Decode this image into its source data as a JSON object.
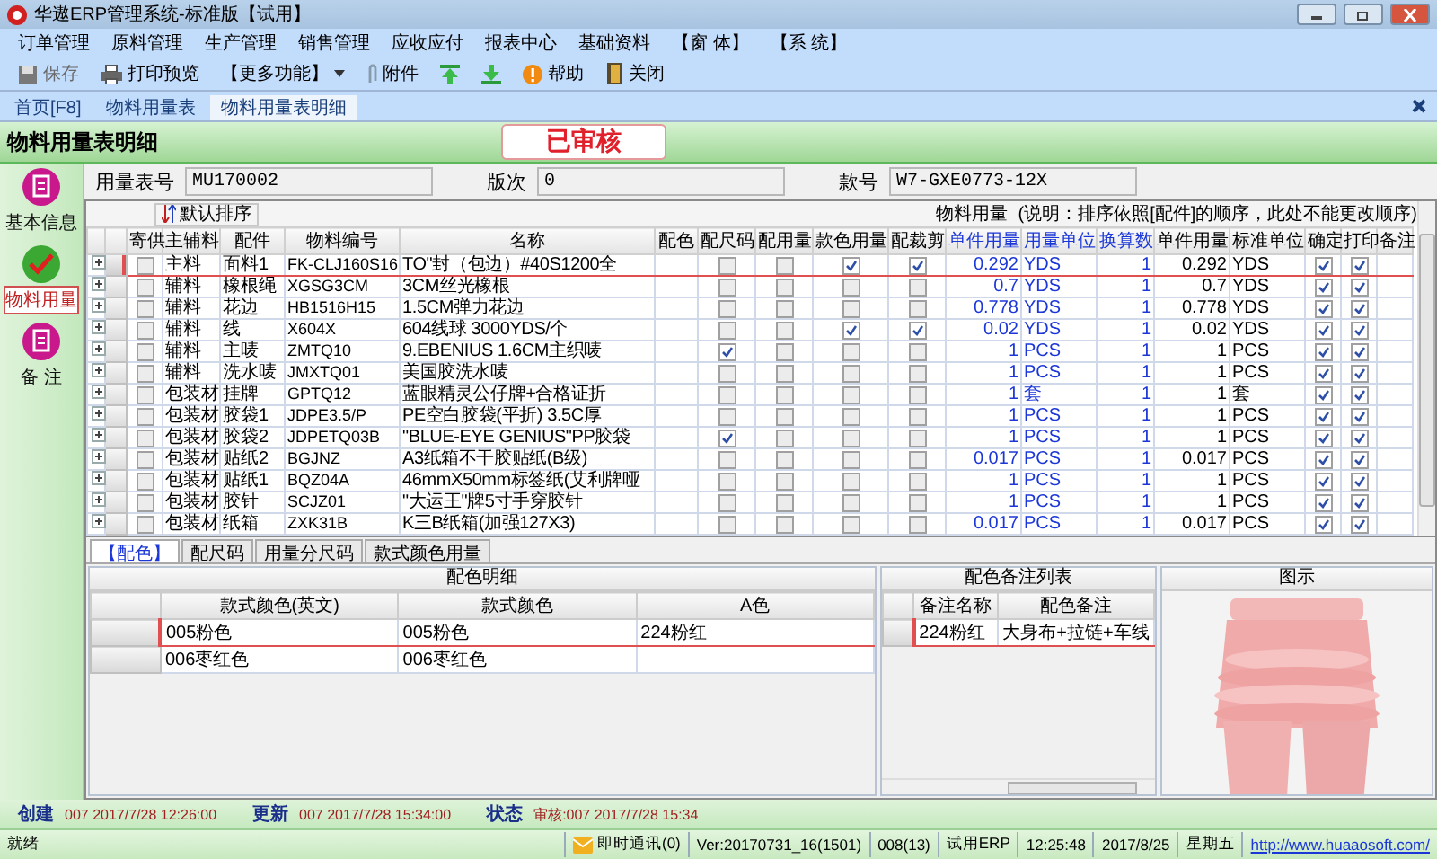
{
  "window": {
    "title": "华遨ERP管理系统-标准版【试用】"
  },
  "menu": [
    "订单管理",
    "原料管理",
    "生产管理",
    "销售管理",
    "应收应付",
    "报表中心",
    "基础资料",
    "【窗 体】",
    "【系 统】"
  ],
  "toolbar": [
    {
      "kind": "save",
      "label": "保存",
      "disabled": true
    },
    {
      "kind": "print",
      "label": "打印预览",
      "disabled": false
    },
    {
      "kind": "more",
      "label": "【更多功能】",
      "disabled": false
    },
    {
      "kind": "attach",
      "label": "附件",
      "disabled": false
    },
    {
      "kind": "up",
      "disabled": false
    },
    {
      "kind": "down",
      "disabled": false
    },
    {
      "kind": "help",
      "label": "帮助",
      "disabled": false
    },
    {
      "kind": "close",
      "label": "关闭",
      "disabled": false
    }
  ],
  "doc_tabs": [
    {
      "label": "首页[F8]",
      "selected": false
    },
    {
      "label": "物料用量表",
      "selected": false
    },
    {
      "label": "物料用量表明细",
      "selected": true
    }
  ],
  "page": {
    "title": "物料用量表明细",
    "status_badge": "已审核"
  },
  "fields": [
    {
      "label": "用量表号",
      "value": "MU170002"
    },
    {
      "label": "版次",
      "value": "0"
    },
    {
      "label": "款号",
      "value": "W7-GXE0773-12X"
    }
  ],
  "sidebar": [
    {
      "label": "基本信息",
      "selected": false
    },
    {
      "label": "物料用量",
      "selected": true
    },
    {
      "label": "备 注",
      "selected": false
    }
  ],
  "grid": {
    "sort_button": "默认排序",
    "caption": "物料用量",
    "note": "(说明：排序依照[配件]的顺序，此处不能更改顺序)",
    "columns": [
      {
        "label": "寄供",
        "editable": false
      },
      {
        "label": "主辅料",
        "editable": false
      },
      {
        "label": "配件",
        "editable": false
      },
      {
        "label": "物料编号",
        "editable": false
      },
      {
        "label": "名称",
        "editable": false
      },
      {
        "label": "配色",
        "editable": false
      },
      {
        "label": "配尺码",
        "editable": false
      },
      {
        "label": "配用量",
        "editable": false
      },
      {
        "label": "款色用量",
        "editable": false
      },
      {
        "label": "配裁剪",
        "editable": false
      },
      {
        "label": "单件用量",
        "editable": true
      },
      {
        "label": "用量单位",
        "editable": true
      },
      {
        "label": "换算数",
        "editable": true
      },
      {
        "label": "单件用量",
        "editable": false
      },
      {
        "label": "标准单位",
        "editable": false
      },
      {
        "label": "确定",
        "editable": false
      },
      {
        "label": "打印",
        "editable": false
      },
      {
        "label": "备注",
        "editable": false
      }
    ],
    "rows": [
      {
        "selected": true,
        "supply": false,
        "type": "主料",
        "part": "面料1",
        "code": "FK-CLJ160S16",
        "name": "TO\"封（包边）#40S1200全",
        "size": false,
        "qty": false,
        "style_color": true,
        "cutting": true,
        "usage": "0.292",
        "unit": "YDS",
        "factor": "1",
        "std_usage": "0.292",
        "std_unit": "YDS",
        "confirm": true,
        "print": true
      },
      {
        "selected": false,
        "supply": false,
        "type": "辅料",
        "part": "橡根绳",
        "code": "XGSG3CM",
        "name": "3CM丝光橡根",
        "size": false,
        "qty": false,
        "style_color": false,
        "cutting": false,
        "usage": "0.7",
        "unit": "YDS",
        "factor": "1",
        "std_usage": "0.7",
        "std_unit": "YDS",
        "confirm": true,
        "print": true
      },
      {
        "selected": false,
        "supply": false,
        "type": "辅料",
        "part": "花边",
        "code": "HB1516H15",
        "name": "1.5CM弹力花边",
        "size": false,
        "qty": false,
        "style_color": false,
        "cutting": false,
        "usage": "0.778",
        "unit": "YDS",
        "factor": "1",
        "std_usage": "0.778",
        "std_unit": "YDS",
        "confirm": true,
        "print": true
      },
      {
        "selected": false,
        "supply": false,
        "type": "辅料",
        "part": "线",
        "code": "X604X",
        "name": "604线球 3000YDS/个",
        "size": false,
        "qty": false,
        "style_color": true,
        "cutting": true,
        "usage": "0.02",
        "unit": "YDS",
        "factor": "1",
        "std_usage": "0.02",
        "std_unit": "YDS",
        "confirm": true,
        "print": true
      },
      {
        "selected": false,
        "supply": false,
        "type": "辅料",
        "part": "主唛",
        "code": "ZMTQ10",
        "name": "9.EBENIUS 1.6CM主织唛",
        "size": true,
        "qty": false,
        "style_color": false,
        "cutting": false,
        "usage": "1",
        "unit": "PCS",
        "factor": "1",
        "std_usage": "1",
        "std_unit": "PCS",
        "confirm": true,
        "print": true
      },
      {
        "selected": false,
        "supply": false,
        "type": "辅料",
        "part": "洗水唛",
        "code": "JMXTQ01",
        "name": "美国胶洗水唛",
        "size": false,
        "qty": false,
        "style_color": false,
        "cutting": false,
        "usage": "1",
        "unit": "PCS",
        "factor": "1",
        "std_usage": "1",
        "std_unit": "PCS",
        "confirm": true,
        "print": true
      },
      {
        "selected": false,
        "supply": false,
        "type": "包装材",
        "part": "挂牌",
        "code": "GPTQ12",
        "name": "蓝眼精灵公仔牌+合格证折",
        "size": false,
        "qty": false,
        "style_color": false,
        "cutting": false,
        "usage": "1",
        "unit": "套",
        "factor": "1",
        "std_usage": "1",
        "std_unit": "套",
        "confirm": true,
        "print": true
      },
      {
        "selected": false,
        "supply": false,
        "type": "包装材",
        "part": "胶袋1",
        "code": "JDPE3.5/P",
        "name": "PE空白胶袋(平折) 3.5C厚",
        "size": false,
        "qty": false,
        "style_color": false,
        "cutting": false,
        "usage": "1",
        "unit": "PCS",
        "factor": "1",
        "std_usage": "1",
        "std_unit": "PCS",
        "confirm": true,
        "print": true
      },
      {
        "selected": false,
        "supply": false,
        "type": "包装材",
        "part": "胶袋2",
        "code": "JDPETQ03B",
        "name": "\"BLUE-EYE GENIUS\"PP胶袋",
        "size": true,
        "qty": false,
        "style_color": false,
        "cutting": false,
        "usage": "1",
        "unit": "PCS",
        "factor": "1",
        "std_usage": "1",
        "std_unit": "PCS",
        "confirm": true,
        "print": true
      },
      {
        "selected": false,
        "supply": false,
        "type": "包装材",
        "part": "贴纸2",
        "code": "BGJNZ",
        "name": "A3纸箱不干胶贴纸(B级)",
        "size": false,
        "qty": false,
        "style_color": false,
        "cutting": false,
        "usage": "0.017",
        "unit": "PCS",
        "factor": "1",
        "std_usage": "0.017",
        "std_unit": "PCS",
        "confirm": true,
        "print": true
      },
      {
        "selected": false,
        "supply": false,
        "type": "包装材",
        "part": "贴纸1",
        "code": "BQZ04A",
        "name": "46mmX50mm标签纸(艾利牌哑",
        "size": false,
        "qty": false,
        "style_color": false,
        "cutting": false,
        "usage": "1",
        "unit": "PCS",
        "factor": "1",
        "std_usage": "1",
        "std_unit": "PCS",
        "confirm": true,
        "print": true
      },
      {
        "selected": false,
        "supply": false,
        "type": "包装材",
        "part": "胶针",
        "code": "SCJZ01",
        "name": "\"大运王\"牌5寸手穿胶针",
        "size": false,
        "qty": false,
        "style_color": false,
        "cutting": false,
        "usage": "1",
        "unit": "PCS",
        "factor": "1",
        "std_usage": "1",
        "std_unit": "PCS",
        "confirm": true,
        "print": true
      },
      {
        "selected": false,
        "supply": false,
        "type": "包装材",
        "part": "纸箱",
        "code": "ZXK31B",
        "name": "K三B纸箱(加强127X3)",
        "size": false,
        "qty": false,
        "style_color": false,
        "cutting": false,
        "usage": "0.017",
        "unit": "PCS",
        "factor": "1",
        "std_usage": "0.017",
        "std_unit": "PCS",
        "confirm": true,
        "print": true
      }
    ]
  },
  "detail_tabs": [
    {
      "label": "【配色】",
      "selected": true
    },
    {
      "label": "配尺码",
      "selected": false
    },
    {
      "label": "用量分尺码",
      "selected": false
    },
    {
      "label": "款式颜色用量",
      "selected": false
    }
  ],
  "color_detail": {
    "title": "配色明细",
    "columns": [
      "款式颜色(英文)",
      "款式颜色",
      "A色"
    ],
    "rows": [
      {
        "selected": true,
        "cells": [
          "005粉色",
          "005粉色",
          "224粉红"
        ]
      },
      {
        "selected": false,
        "cells": [
          "006枣红色",
          "006枣红色"
        ]
      }
    ]
  },
  "color_notes": {
    "title": "配色备注列表",
    "columns": [
      "备注名称",
      "配色备注"
    ],
    "rows": [
      {
        "selected": true,
        "cells": [
          "224粉红",
          "大身布+拉链+车线"
        ]
      }
    ]
  },
  "illustration": {
    "title": "图示"
  },
  "info": [
    {
      "label": "创建",
      "value": "007 2017/7/28 12:26:00"
    },
    {
      "label": "更新",
      "value": "007 2017/7/28 15:34:00"
    },
    {
      "label": "状态",
      "value": "审核:007 2017/7/28 15:34"
    }
  ],
  "status_bar": {
    "left": "就绪",
    "items": [
      {
        "kind": "im",
        "text": "即时通讯(0)"
      },
      {
        "kind": "text",
        "text": "Ver:20170731_16(1501)"
      },
      {
        "kind": "text",
        "text": "008(13)"
      },
      {
        "kind": "text",
        "text": "试用ERP"
      },
      {
        "kind": "text",
        "text": "12:25:48"
      },
      {
        "kind": "text",
        "text": "2017/8/25"
      },
      {
        "kind": "text",
        "text": "星期五"
      },
      {
        "kind": "link",
        "text": "http://www.huaaosoft.com/"
      }
    ]
  }
}
